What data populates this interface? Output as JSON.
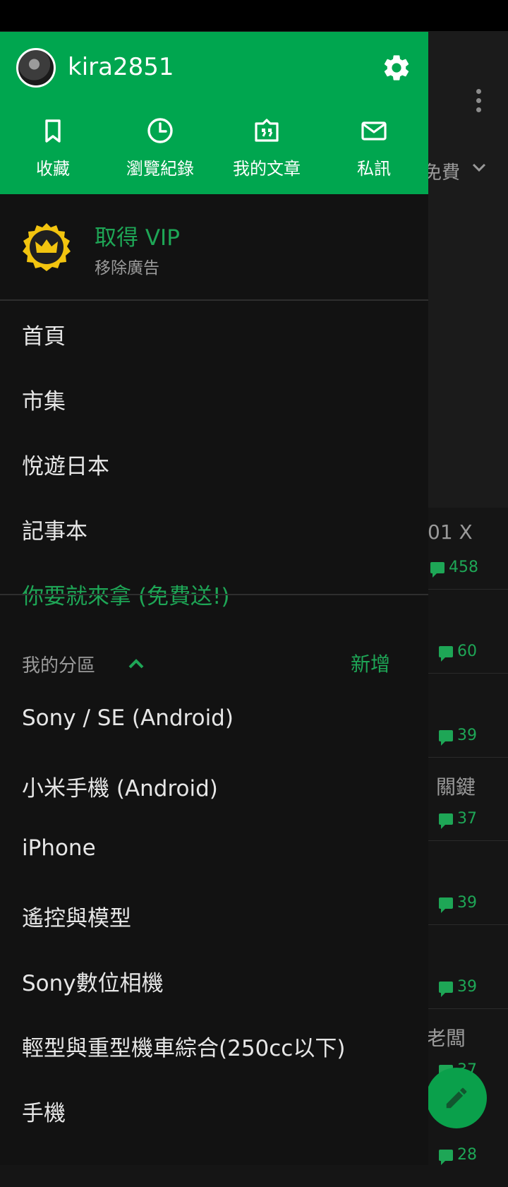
{
  "background": {
    "filter_label": "免費",
    "rows": [
      {
        "title": "01 X",
        "count": "458"
      },
      {
        "title": "",
        "count": "60"
      },
      {
        "title": "",
        "count": "39"
      },
      {
        "title": "關鍵",
        "count": "37"
      },
      {
        "title": "",
        "count": "39"
      },
      {
        "title": "",
        "count": "39"
      },
      {
        "title": "老闆",
        "count": "37"
      },
      {
        "title": "",
        "count": "28"
      }
    ]
  },
  "drawer": {
    "username": "kira2851",
    "quick_actions": [
      {
        "label": "收藏",
        "icon": "bookmark-icon"
      },
      {
        "label": "瀏覽紀錄",
        "icon": "clock-icon"
      },
      {
        "label": "我的文章",
        "icon": "article-icon"
      },
      {
        "label": "私訊",
        "icon": "mail-icon"
      }
    ],
    "vip": {
      "title": "取得 VIP",
      "subtitle": "移除廣告"
    },
    "menu": [
      {
        "label": "首頁"
      },
      {
        "label": "市集"
      },
      {
        "label": "悅遊日本"
      },
      {
        "label": "記事本"
      },
      {
        "label": "你要就來拿 (免費送!)"
      }
    ],
    "section": {
      "title": "我的分區",
      "add_label": "新增"
    },
    "boards": [
      {
        "label": "Sony / SE (Android)"
      },
      {
        "label": "小米手機 (Android)"
      },
      {
        "label": "iPhone"
      },
      {
        "label": "遙控與模型"
      },
      {
        "label": "Sony數位相機"
      },
      {
        "label": "輕型與重型機車綜合(250cc以下)"
      },
      {
        "label": "手機"
      }
    ]
  },
  "colors": {
    "accent": "#00a64f",
    "accent_text": "#1ea656",
    "drawer_bg": "#121212",
    "vip_badge": "#f2c40f"
  }
}
